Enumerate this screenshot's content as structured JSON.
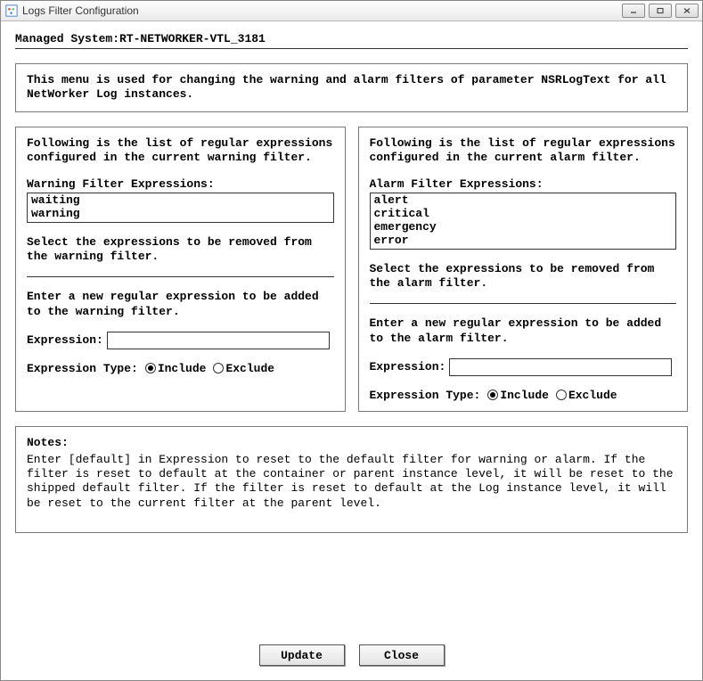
{
  "window": {
    "title": "Logs Filter Configuration"
  },
  "header": {
    "managed_system_label": "Managed System:",
    "managed_system_value": "RT-NETWORKER-VTL_3181"
  },
  "intro": {
    "text": "This menu is used for changing the warning and alarm filters of parameter NSRLogText for all NetWorker Log instances."
  },
  "warning": {
    "desc": "Following is the list of regular expressions configured in the current warning filter.",
    "list_label": "Warning Filter Expressions:",
    "items": [
      "waiting",
      "warning"
    ],
    "remove_text": "Select the expressions to be removed from the warning filter.",
    "add_text": "Enter a new regular expression to be added to the warning filter.",
    "expression_label": "Expression:",
    "expression_value": "",
    "type_label": "Expression Type:",
    "include_label": "Include",
    "exclude_label": "Exclude",
    "type_selected": "include"
  },
  "alarm": {
    "desc": "Following is the list of regular expressions configured in the current alarm filter.",
    "list_label": "Alarm Filter Expressions:",
    "items": [
      "alert",
      "critical",
      "emergency",
      "error"
    ],
    "remove_text": "Select the expressions to be removed from the alarm filter.",
    "add_text": "Enter a new regular expression to be added to the alarm filter.",
    "expression_label": "Expression:",
    "expression_value": "",
    "type_label": "Expression Type:",
    "include_label": "Include",
    "exclude_label": "Exclude",
    "type_selected": "include"
  },
  "notes": {
    "title": "Notes:",
    "body": "Enter [default] in Expression to reset to the default filter for warning or alarm. If the filter is reset to default at the container or parent instance level, it will be reset to the shipped default filter. If the filter is reset to default at the Log instance level, it will be reset to the current filter at the parent level."
  },
  "buttons": {
    "update": "Update",
    "close": "Close"
  }
}
